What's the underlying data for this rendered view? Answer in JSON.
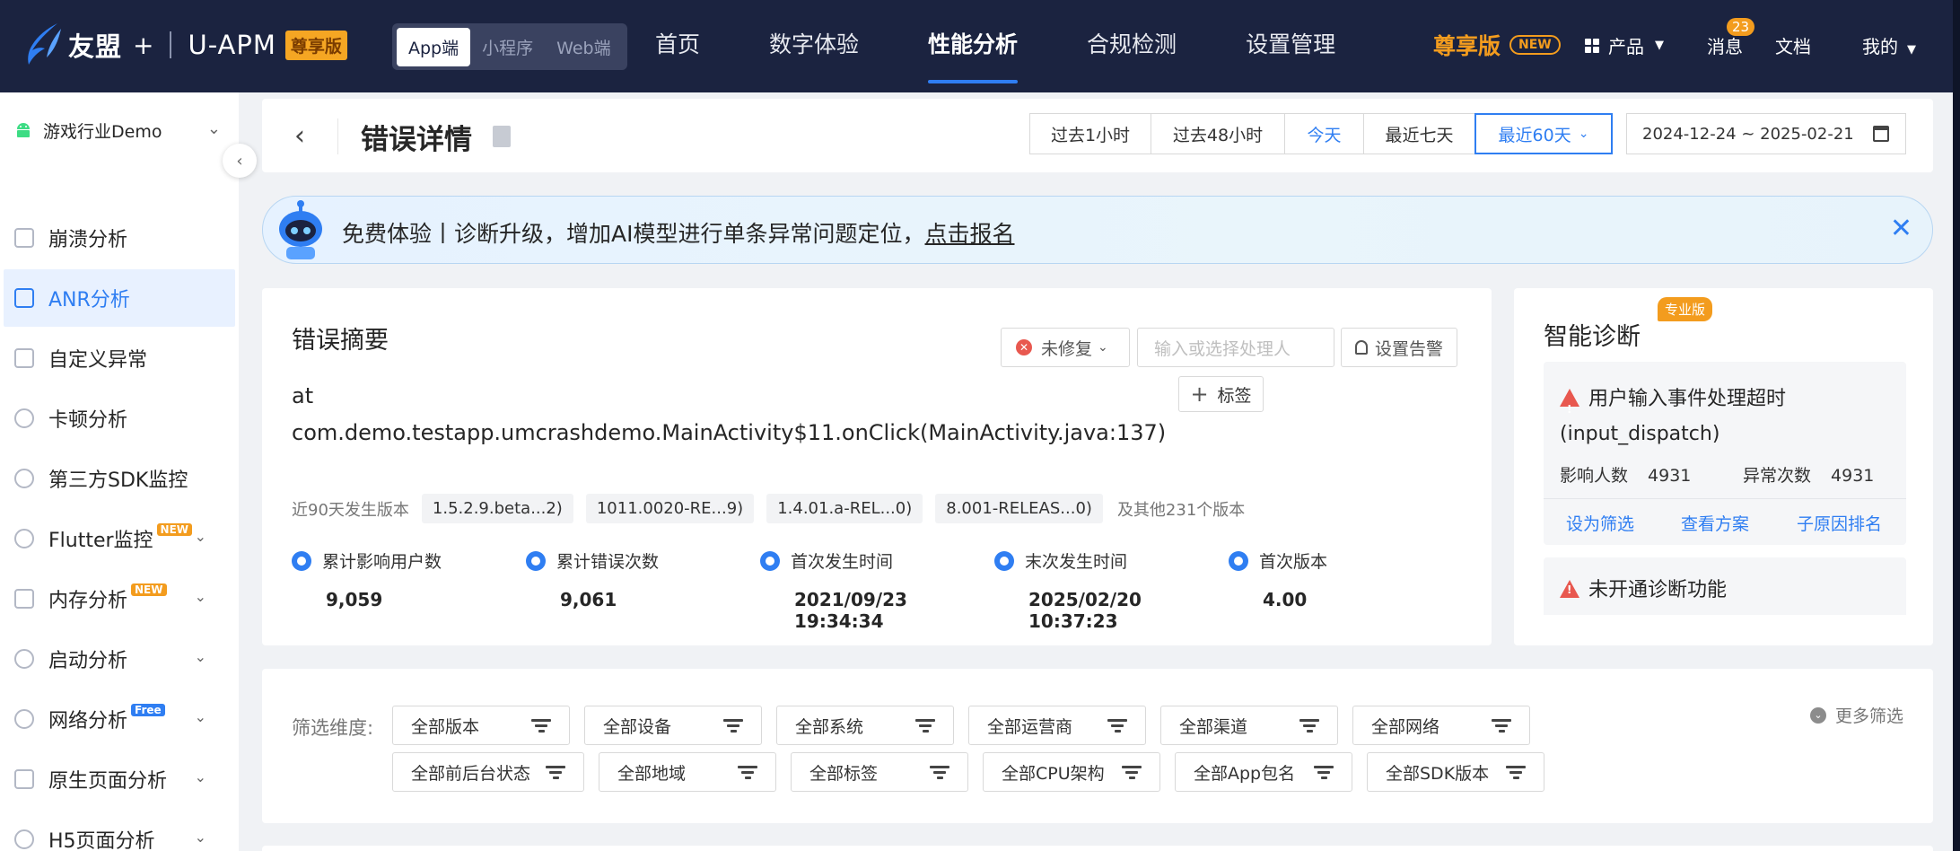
{
  "topbar": {
    "brand": "友盟",
    "plus": "+",
    "product": "U-APM",
    "edition_badge": "尊享版",
    "platforms": [
      {
        "label": "App端",
        "active": true
      },
      {
        "label": "小程序",
        "active": false
      },
      {
        "label": "Web端",
        "active": false
      }
    ],
    "nav": [
      {
        "label": "首页",
        "active": false
      },
      {
        "label": "数字体验",
        "active": false
      },
      {
        "label": "性能分析",
        "active": true
      },
      {
        "label": "合规检测",
        "active": false
      },
      {
        "label": "设置管理",
        "active": false
      }
    ],
    "vip_label": "尊享版",
    "vip_new": "NEW",
    "products": "产品",
    "messages": "消息",
    "message_count": "23",
    "docs": "文档",
    "mine": "我的"
  },
  "sidebar": {
    "app_name": "游戏行业Demo",
    "items": [
      {
        "label": "崩溃分析",
        "active": false
      },
      {
        "label": "ANR分析",
        "active": true
      },
      {
        "label": "自定义异常",
        "active": false
      },
      {
        "label": "卡顿分析",
        "active": false
      },
      {
        "label": "第三方SDK监控",
        "active": false
      },
      {
        "label": "Flutter监控",
        "tag": "NEW",
        "expandable": true
      },
      {
        "label": "内存分析",
        "tag": "NEW",
        "expandable": true
      },
      {
        "label": "启动分析",
        "expandable": true
      },
      {
        "label": "网络分析",
        "tag": "Free",
        "expandable": true
      },
      {
        "label": "原生页面分析",
        "expandable": true
      },
      {
        "label": "H5页面分析",
        "expandable": true
      }
    ]
  },
  "header": {
    "title": "错误详情",
    "ranges": [
      "过去1小时",
      "过去48小时",
      "今天",
      "最近七天",
      "最近60天"
    ],
    "selected_range": "最近60天",
    "date_range": "2024-12-24 ~ 2025-02-21"
  },
  "banner": {
    "text": "免费体验丨诊断升级，增加AI模型进行单条异常问题定位，",
    "link": "点击报名"
  },
  "summary": {
    "title": "错误摘要",
    "status": "未修复",
    "assignee_placeholder": "输入或选择处理人",
    "alarm_label": "设置告警",
    "tag_label": "标签",
    "stack_line1": "at",
    "stack_line2": "com.demo.testapp.umcrashdemo.MainActivity$11.onClick(MainActivity.java:137)",
    "versions_label": "近90天发生版本",
    "versions": [
      "1.5.2.9.beta...2)",
      "1011.0020-RE...9)",
      "1.4.01.a-REL...0)",
      "8.001-RELEAS...0)"
    ],
    "versions_more": "及其他231个版本",
    "stats": [
      {
        "label": "累计影响用户数",
        "value": "9,059"
      },
      {
        "label": "累计错误次数",
        "value": "9,061"
      },
      {
        "label": "首次发生时间",
        "value": "2021/09/23 19:34:34"
      },
      {
        "label": "末次发生时间",
        "value": "2025/02/20 10:37:23"
      },
      {
        "label": "首次版本",
        "value": "4.00"
      }
    ]
  },
  "diagnosis": {
    "title": "智能诊断",
    "badge": "专业版",
    "item1_title": "用户输入事件处理超时(input_dispatch)",
    "affected_label": "影响人数",
    "affected_value": "4931",
    "count_label": "异常次数",
    "count_value": "4931",
    "actions": [
      "设为筛选",
      "查看方案",
      "子原因排名"
    ],
    "item2_title": "未开通诊断功能"
  },
  "filters": {
    "label": "筛选维度:",
    "row1": [
      "全部版本",
      "全部设备",
      "全部系统",
      "全部运营商",
      "全部渠道",
      "全部网络"
    ],
    "row2": [
      "全部前后台状态",
      "全部地域",
      "全部标签",
      "全部CPU架构",
      "全部App包名",
      "全部SDK版本"
    ],
    "more": "更多筛选"
  },
  "colors": {
    "nav_bg": "#1b2340",
    "primary": "#2f7ef2",
    "accent": "#f39c1e",
    "danger": "#e8584f"
  }
}
